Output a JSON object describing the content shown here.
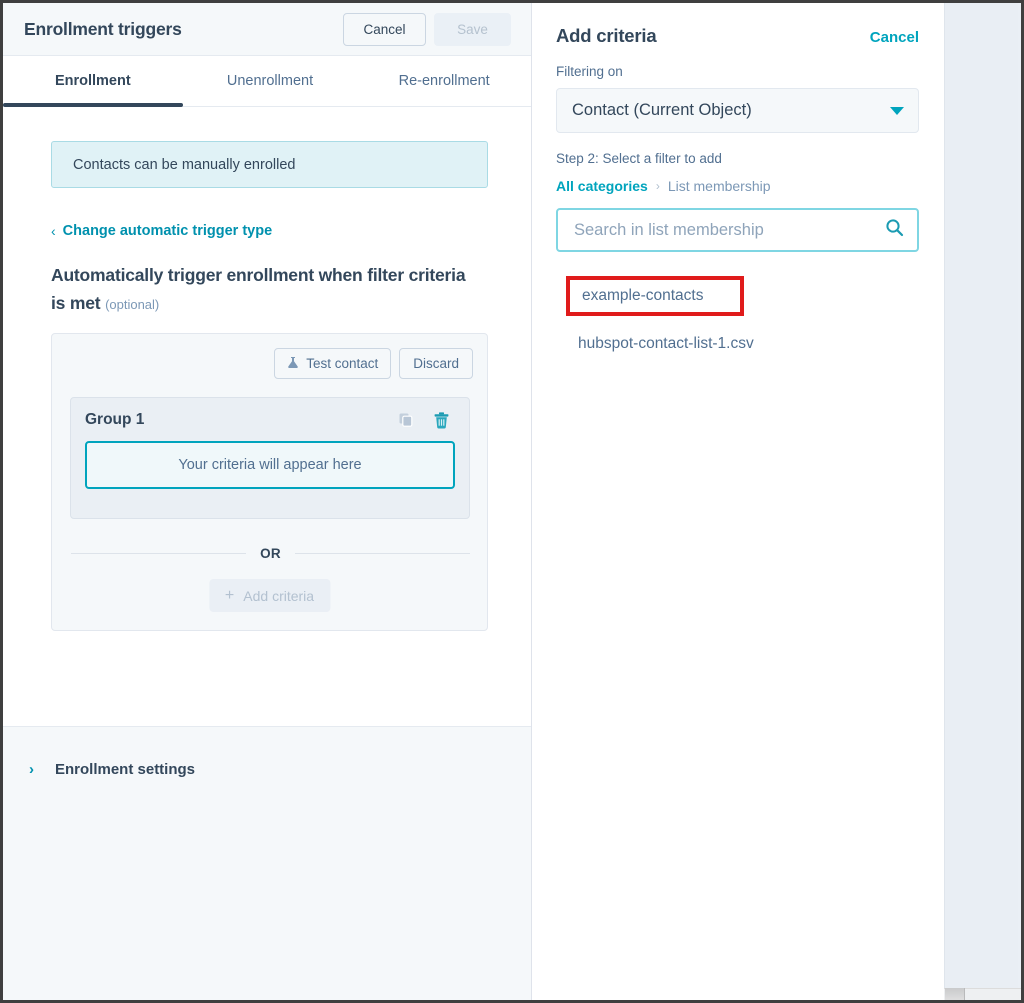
{
  "left_panel": {
    "header": {
      "title": "Enrollment triggers",
      "cancel_label": "Cancel",
      "save_label": "Save"
    },
    "tabs": [
      {
        "label": "Enrollment",
        "active": true
      },
      {
        "label": "Unenrollment",
        "active": false
      },
      {
        "label": "Re-enrollment",
        "active": false
      }
    ],
    "notice": "Contacts can be manually enrolled",
    "change_trigger_link": "Change automatic trigger type",
    "change_trigger_chevron": "‹",
    "heading": "Automatically trigger enrollment when filter criteria is met",
    "heading_optional": "(optional)",
    "criteria_card": {
      "test_contact_label": "Test contact",
      "discard_label": "Discard",
      "group_title": "Group 1",
      "copy_icon_name": "copy-icon",
      "delete_icon_name": "trash-icon",
      "placeholder": "Your criteria will appear here",
      "or_label": "OR",
      "add_criteria_label": "Add criteria",
      "add_criteria_plus": "+"
    },
    "settings": {
      "chevron": "›",
      "label": "Enrollment settings"
    }
  },
  "right_panel": {
    "title": "Add criteria",
    "cancel_label": "Cancel",
    "filtering_on_label": "Filtering on",
    "object_select_value": "Contact (Current Object)",
    "step_text": "Step 2: Select a filter to add",
    "breadcrumb": {
      "root": "All categories",
      "separator": "›",
      "current": "List membership"
    },
    "search_placeholder": "Search in list membership",
    "search_value": "",
    "search_icon_name": "search-icon",
    "results": [
      {
        "label": "example-contacts",
        "highlighted": true
      },
      {
        "label": "hubspot-contact-list-1.csv",
        "highlighted": false
      }
    ]
  },
  "colors": {
    "accent_teal": "#00a4bd",
    "link_teal": "#0091ae",
    "text_dark": "#33475b",
    "text_muted": "#516f90",
    "panel_bg": "#f5f8fa",
    "notice_bg": "#e0f2f6",
    "highlight_red": "#e01b1b"
  }
}
